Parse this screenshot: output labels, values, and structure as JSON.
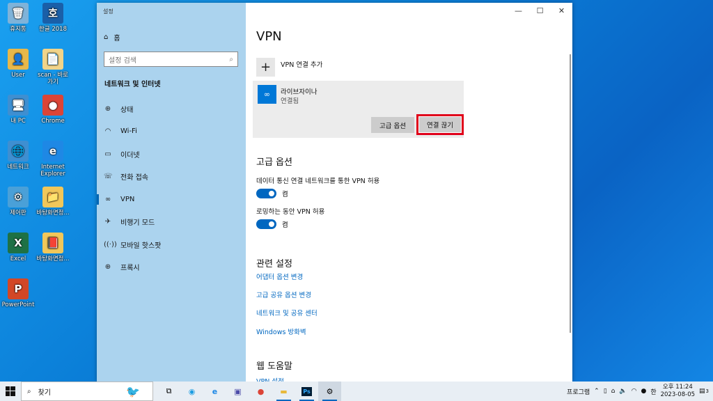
{
  "desktop": {
    "icons": [
      {
        "label": "휴지통",
        "glyph": "🗑",
        "color": "#7fb3d9"
      },
      {
        "label": "한글 2018",
        "glyph": "호",
        "color": "#1a5fa8"
      },
      {
        "label": "User",
        "glyph": "👤",
        "color": "#e7b84a"
      },
      {
        "label": "scan - 바로 가기",
        "glyph": "📄",
        "color": "#f1d48a"
      },
      {
        "label": "내 PC",
        "glyph": "🖥",
        "color": "#3e8fd1"
      },
      {
        "label": "Chrome",
        "glyph": "●",
        "color": "#db4437"
      },
      {
        "label": "네트워크",
        "glyph": "🌐",
        "color": "#3e8fd1"
      },
      {
        "label": "Internet Explorer",
        "glyph": "e",
        "color": "#1e88e5"
      },
      {
        "label": "제어판",
        "glyph": "⚙",
        "color": "#4aa0d8"
      },
      {
        "label": "바탕화면정...",
        "glyph": "📁",
        "color": "#f1c75a"
      },
      {
        "label": "Excel",
        "glyph": "X",
        "color": "#1e7145"
      },
      {
        "label": "바탕화면정...",
        "glyph": "📕",
        "color": "#f1c75a"
      },
      {
        "label": "PowerPoint",
        "glyph": "P",
        "color": "#d24726"
      }
    ]
  },
  "window": {
    "title": "설정",
    "minimize": "—",
    "maximize": "☐",
    "close": "✕"
  },
  "sidebar": {
    "home": "홈",
    "search_placeholder": "설정 검색",
    "section": "네트워크 및 인터넷",
    "items": [
      {
        "label": "상태",
        "icon": "⊕"
      },
      {
        "label": "Wi-Fi",
        "icon": "◠"
      },
      {
        "label": "이더넷",
        "icon": "▭"
      },
      {
        "label": "전화 접속",
        "icon": "☏"
      },
      {
        "label": "VPN",
        "icon": "∞"
      },
      {
        "label": "비행기 모드",
        "icon": "✈"
      },
      {
        "label": "모바일 핫스팟",
        "icon": "((·))"
      },
      {
        "label": "프록시",
        "icon": "⊕"
      }
    ]
  },
  "content": {
    "title": "VPN",
    "add_vpn": "VPN 연결 추가",
    "vpn_connection": {
      "name": "라이브자이나",
      "status": "연결됨",
      "advanced_button": "고급 옵션",
      "disconnect_button": "연결 끊기"
    },
    "advanced_title": "고급 옵션",
    "option1_label": "데이터 통신 연결 네트워크를 통한 VPN 허용",
    "option1_state": "켬",
    "option2_label": "로밍하는 동안 VPN 허용",
    "option2_state": "켬",
    "related_title": "관련 설정",
    "links": [
      "어댑터 옵션 변경",
      "고급 공유 옵션 변경",
      "네트워크 및 공유 센터",
      "Windows 방화벽"
    ],
    "help_title": "웹 도움말",
    "help_link": "VPN 설정"
  },
  "taskbar": {
    "search_text": "찾기",
    "program_label": "프로그램",
    "ime": "한",
    "time": "오후 11:24",
    "date": "2023-08-05",
    "notification_count": "3"
  }
}
